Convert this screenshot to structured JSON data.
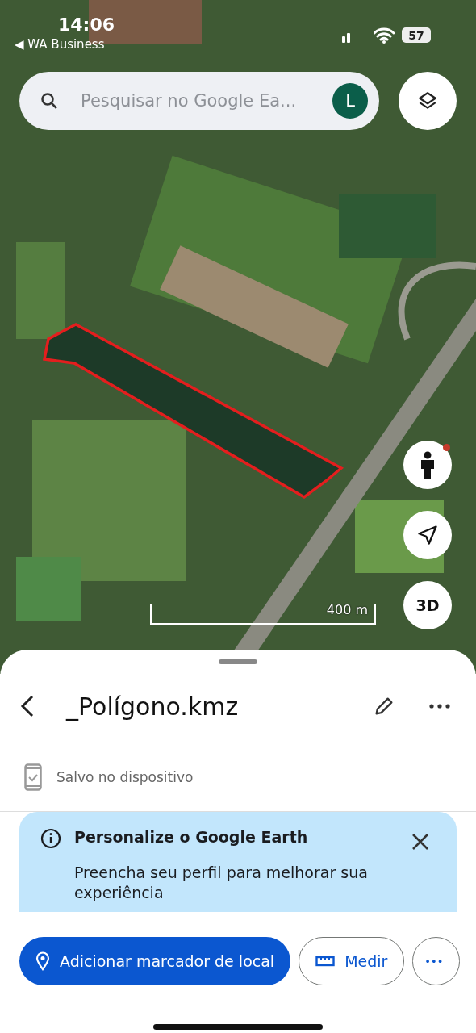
{
  "status_bar": {
    "time": "14:06",
    "back_app": "◀ WA Business",
    "battery": "57"
  },
  "search": {
    "placeholder": "Pesquisar no Google Ea...",
    "avatar": "L"
  },
  "map": {
    "scale": "400 m",
    "map_buttons": [
      {
        "kind": "pegman"
      },
      {
        "kind": "locate"
      },
      {
        "kind": "label",
        "label": "3D"
      }
    ]
  },
  "sheet": {
    "title": "_Polígono.kmz",
    "saved": "Salvo no dispositivo",
    "banner": {
      "title": "Personalize o Google Earth",
      "text": "Preencha seu perfil para melhorar sua experiência"
    },
    "actions": [
      {
        "kind": "primary",
        "label": "Adicionar marcador de local"
      },
      {
        "kind": "measure",
        "label": "Medir"
      },
      {
        "kind": "more",
        "label": "•••"
      }
    ]
  }
}
